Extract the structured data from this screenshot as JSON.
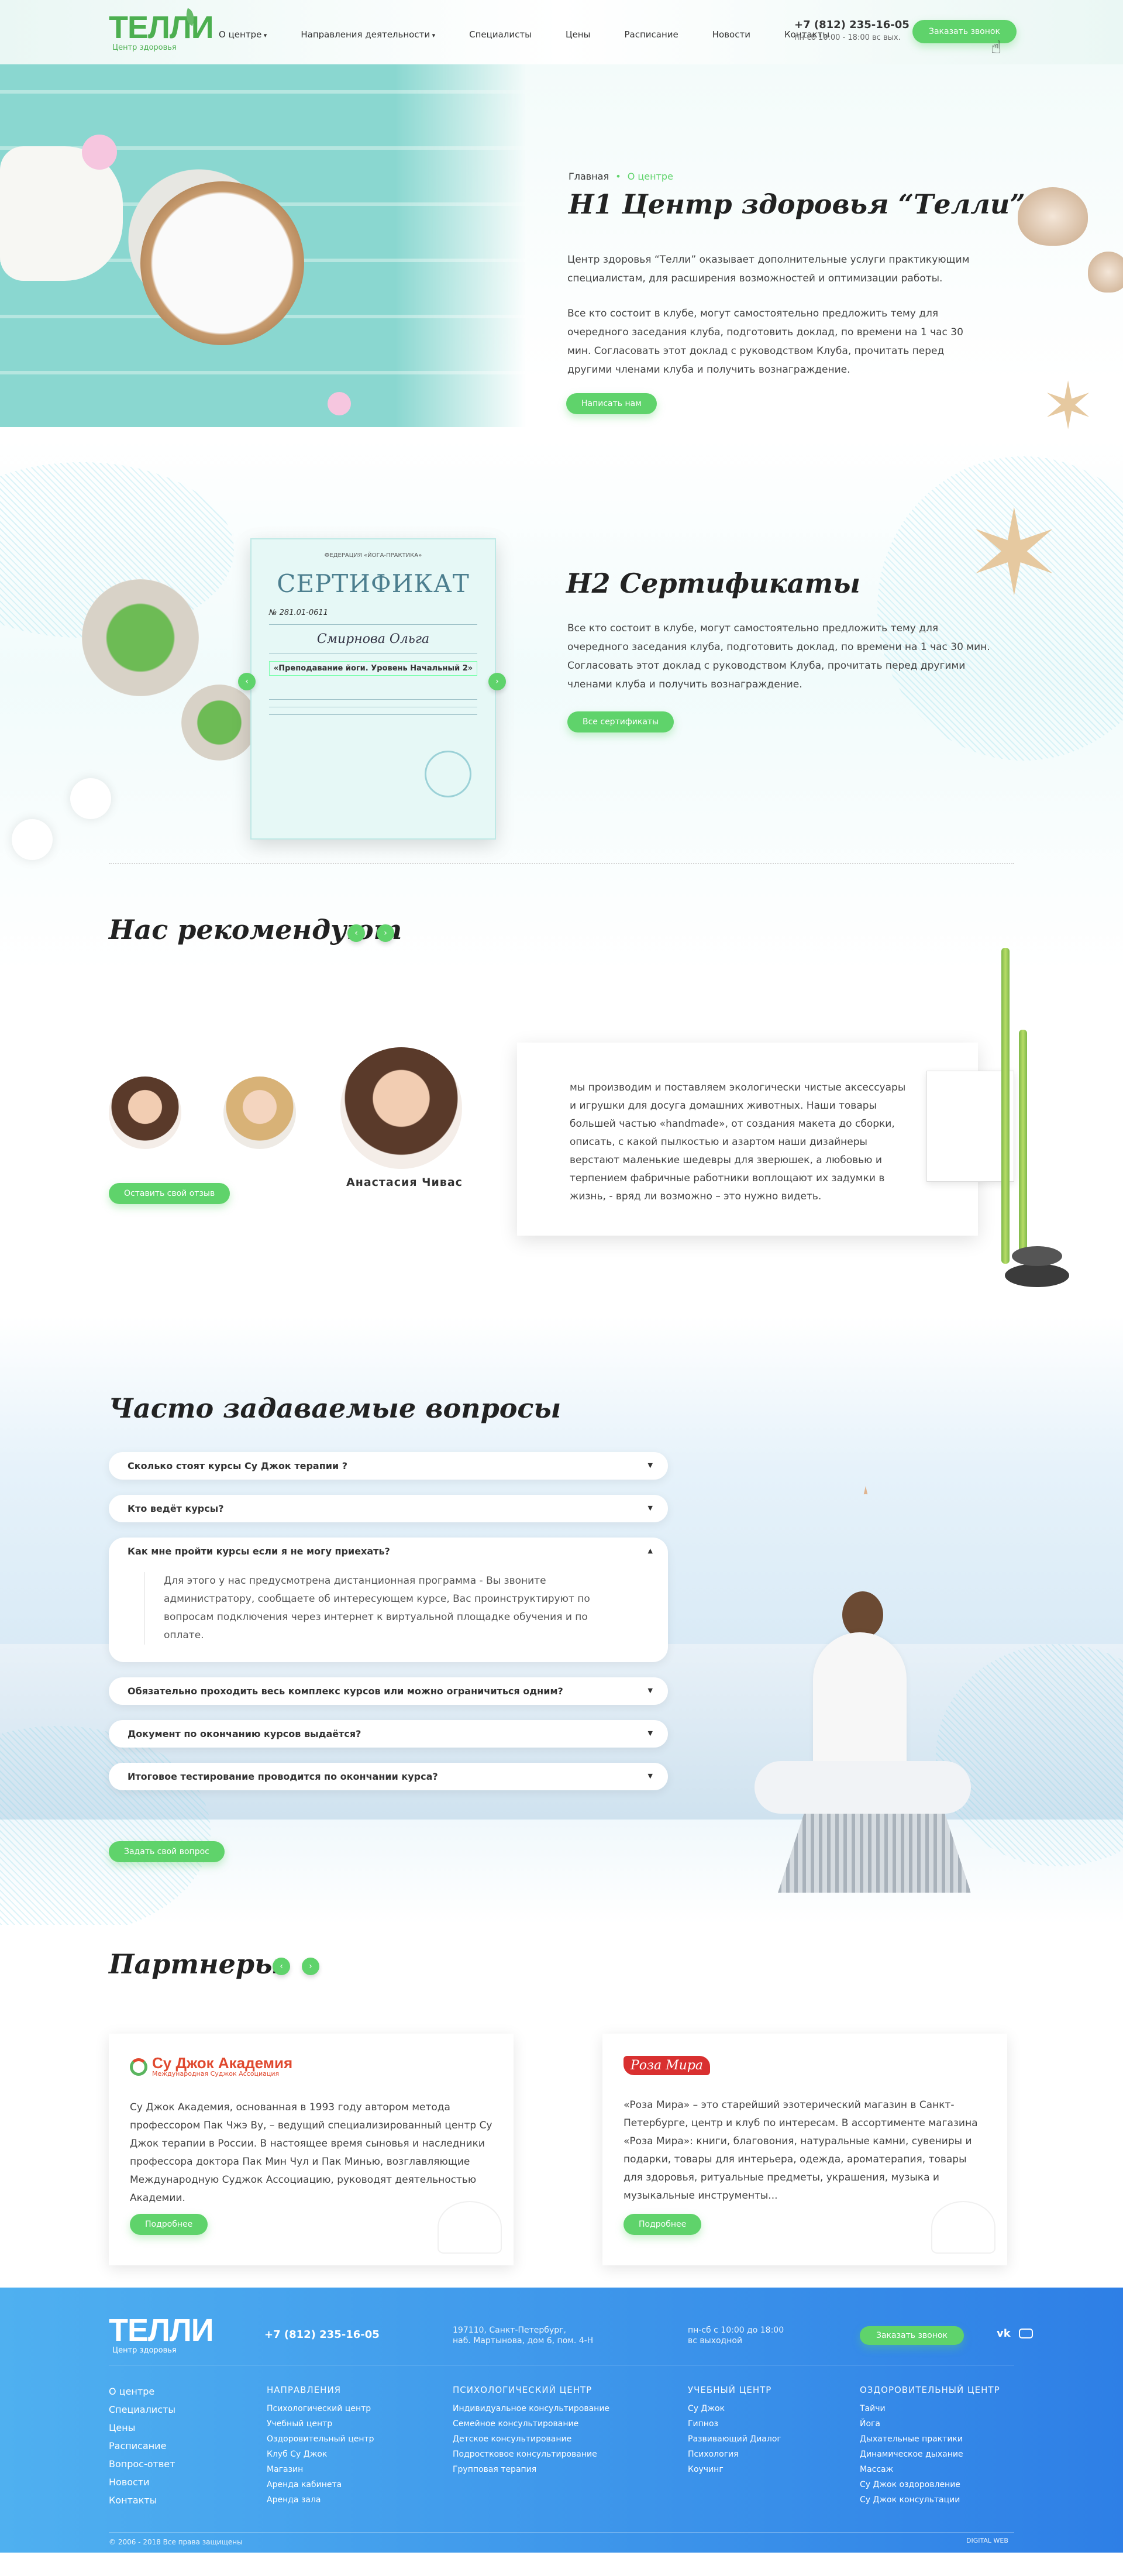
{
  "header": {
    "logo": "ТЕЛЛИ",
    "logo_sub": "Центр здоровья",
    "nav": [
      {
        "label": "О центре"
      },
      {
        "label": "Направления деятельности"
      },
      {
        "label": "Специалисты"
      },
      {
        "label": "Цены"
      },
      {
        "label": "Расписание"
      },
      {
        "label": "Новости"
      },
      {
        "label": "Контакты"
      }
    ],
    "phone": "+7 (812) 235-16-05",
    "hours": "пн-сб 10:00 - 18:00 вс вых.",
    "callback_button": "Заказать звонок"
  },
  "hero": {
    "breadcrumb_home": "Главная",
    "breadcrumb_sep": "•",
    "breadcrumb_current": "О центре",
    "title": "Н1 Центр здоровья “Телли”",
    "paragraph1": "Центр здоровья “Телли” оказывает дополнительные услуги практикующим специалистам, для расширения возможностей и оптимизации работы.",
    "paragraph2": "Все кто состоит в клубе, могут самостоятельно предложить тему для очередного заседания клуба, подготовить доклад, по времени на 1 час 30 мин. Согласовать этот доклад с руководством Клуба, прочитать перед другими членами клуба и получить вознаграждение.",
    "button": "Написать нам"
  },
  "certificates": {
    "title": "Н2 Сертификаты",
    "paragraph": "Все кто состоит в клубе, могут самостоятельно предложить тему для очередного заседания клуба, подготовить доклад, по времени на 1 час 30 мин. Согласовать этот доклад с руководством Клуба, прочитать перед другими членами клуба и получить вознаграждение.",
    "button": "Все сертификаты",
    "cert_header": "ФЕДЕРАЦИЯ «ЙОГА-ПРАКТИКА»",
    "cert_title": "СЕРТИФИКАТ",
    "cert_number": "№ 281.01-0611",
    "cert_name": "Смирнова Ольга",
    "cert_course": "«Преподавание йоги. Уровень Начальный 2»",
    "prev": "‹",
    "next": "›"
  },
  "reviews": {
    "title": "Нас рекомендуют",
    "prev": "‹",
    "next": "›",
    "name": "Анастасия Чивас",
    "button": "Оставить свой отзыв",
    "text": "мы производим и поставляем экологически чистые аксессуары и игрушки для досуга домашних животных. Наши товары большей частью «handmade», от создания макета до сборки, описать, с какой пылкостью и азартом наши дизайнеры верстают маленькие шедевры для зверюшек, а любовью и терпением фабричные работники воплощают их задумки в жизнь, - вряд ли возможно – это нужно видеть."
  },
  "faq": {
    "title": "Часто задаваемые вопросы",
    "items": [
      {
        "q": "Сколько стоят курсы Су Джок терапии ?"
      },
      {
        "q": "Кто ведёт курсы?"
      },
      {
        "q": "Как мне пройти курсы если я не могу приехать?",
        "a": "Для этого у нас предусмотрена дистанционная программа - Вы звоните администратору, сообщаете об интересующем курсе, Вас проинструктируют по вопросам подключения через интернет к виртуальной площадке обучения и по оплате."
      },
      {
        "q": "Обязательно проходить весь комплекс курсов или можно ограничиться одним?"
      },
      {
        "q": "Документ по окончанию курсов выдаётся?"
      },
      {
        "q": "Итоговое тестирование проводится по окончании курса?"
      }
    ],
    "button": "Задать свой вопрос"
  },
  "partners": {
    "title": "Партнеры",
    "prev": "‹",
    "next": "›",
    "cards": [
      {
        "logo_title": "Су Джок Академия",
        "logo_sub": "Международная Суджок Ассоциация",
        "text": "Су Джок Академия, основанная в 1993 году автором метода профессором Пак Чжэ Ву, – ведущий специализированный центр Су Джок терапии в России. В настоящее время сыновья и наследники профессора доктора Пак Мин Чул и Пак Минью, возглавляющие Международную Суджок Ассоциацию, руководят деятельностью Академии.",
        "button": "Подробнее"
      },
      {
        "logo_title": "Роза Мира",
        "text": "«Роза Мира» – это старейший эзотерический магазин в Санкт-Петербурге, центр и клуб по интересам. В ассортименте магазина «Роза Мира»: книги, благовония, натуральные камни, сувениры и подарки, товары для интерьера, одежда, ароматерапия, товары для здоровья, ритуальные предметы, украшения, музыка и музыкальные инструменты...",
        "button": "Подробнее"
      }
    ]
  },
  "footer": {
    "logo": "ТЕЛЛИ",
    "logo_sub": "Центр здоровья",
    "phone": "+7 (812) 235-16-05",
    "address1": "197110, Санкт-Петербург,",
    "address2": "наб. Мартынова, дом 6, пом. 4-Н",
    "hours1": "пн-сб с 10:00 до 18:00",
    "hours2": "вс выходной",
    "button": "Заказать звонок",
    "vk": "vk",
    "main_links": [
      "О центре",
      "Специалисты",
      "Цены",
      "Расписание",
      "Вопрос-ответ",
      "Новости",
      "Контакты"
    ],
    "columns": [
      {
        "heading": "НАПРАВЛЕНИЯ",
        "links": [
          "Психологический центр",
          "Учебный центр",
          "Оздоровительный центр",
          "Клуб Су Джок",
          "Магазин",
          "Аренда кабинета",
          "Аренда зала"
        ]
      },
      {
        "heading": "ПСИХОЛОГИЧЕСКИЙ ЦЕНТР",
        "links": [
          "Индивидуальное консультирование",
          "Семейное консультирование",
          "Детское консультирование",
          "Подростковое консультирование",
          "Групповая терапия"
        ]
      },
      {
        "heading": "УЧЕБНЫЙ ЦЕНТР",
        "links": [
          "Су Джок",
          "Гипноз",
          "Развивающий Диалог",
          "Психология",
          "Коучинг"
        ]
      },
      {
        "heading": "ОЗДОРОВИТЕЛЬНЫЙ ЦЕНТР",
        "links": [
          "Тайчи",
          "Йога",
          "Дыхательные практики",
          "Динамическое дыхание",
          "Массаж",
          "Су Джок оздоровление",
          "Су Джок консультации"
        ]
      }
    ],
    "copyright": "© 2006 - 2018 Все права защищены",
    "developer": "DIGITAL WEB"
  },
  "colors": {
    "accent": "#5fd36b",
    "footer_from": "#4fb0f0",
    "footer_to": "#2e7fe6"
  }
}
